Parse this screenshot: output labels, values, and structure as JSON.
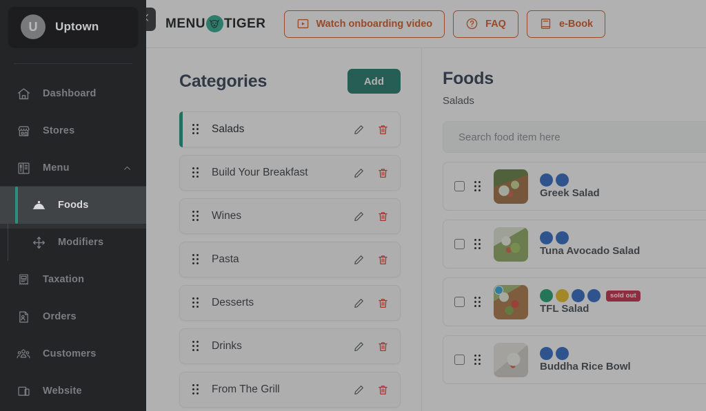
{
  "sidebar": {
    "brand": {
      "initial": "U",
      "name": "Uptown"
    },
    "items": [
      {
        "label": "Dashboard",
        "icon": "home-icon"
      },
      {
        "label": "Stores",
        "icon": "store-icon"
      },
      {
        "label": "Menu",
        "icon": "menu-book-icon",
        "expanded": true
      },
      {
        "label": "Foods",
        "icon": "food-cloche-icon",
        "sub": true,
        "active": true
      },
      {
        "label": "Modifiers",
        "icon": "move-arrows-icon",
        "sub": true
      },
      {
        "label": "Taxation",
        "icon": "tax-receipt-icon"
      },
      {
        "label": "Orders",
        "icon": "orders-icon"
      },
      {
        "label": "Customers",
        "icon": "customers-icon"
      },
      {
        "label": "Website",
        "icon": "website-icon"
      }
    ]
  },
  "topbar": {
    "collapse_icon": "chevron-left-icon",
    "logo": {
      "text_left": "MENU",
      "text_right": "TIGER",
      "mark": "tiger-face-icon"
    },
    "buttons": [
      {
        "label": "Watch onboarding video",
        "icon": "play-video-icon"
      },
      {
        "label": "FAQ",
        "icon": "question-circle-icon"
      },
      {
        "label": "e-Book",
        "icon": "book-icon"
      }
    ]
  },
  "categories": {
    "title": "Categories",
    "add_label": "Add",
    "items": [
      {
        "name": "Salads",
        "active": true
      },
      {
        "name": "Build Your Breakfast",
        "active": false
      },
      {
        "name": "Wines",
        "active": false
      },
      {
        "name": "Pasta",
        "active": false
      },
      {
        "name": "Desserts",
        "active": false
      },
      {
        "name": "Drinks",
        "active": false
      },
      {
        "name": "From The Grill",
        "active": false
      }
    ]
  },
  "foods": {
    "title": "Foods",
    "subtitle": "Salads",
    "search_placeholder": "Search food item here",
    "items": [
      {
        "name": "Greek Salad",
        "thumb": "greek-salad-photo",
        "corner_badge": false,
        "badges": [
          "allergen-blue-icon",
          "dietary-blue-icon"
        ],
        "sold_out": false,
        "sold_out_label": ""
      },
      {
        "name": "Tuna Avocado Salad",
        "thumb": "tuna-avocado-salad-photo",
        "corner_badge": false,
        "badges": [
          "allergen-blue-icon",
          "dietary-blue-icon"
        ],
        "sold_out": false,
        "sold_out_label": ""
      },
      {
        "name": "TFL Salad",
        "thumb": "tfl-salad-photo",
        "corner_badge": true,
        "badges": [
          "new-green-icon",
          "featured-star-icon",
          "allergen-blue-icon",
          "dietary-blue-icon"
        ],
        "sold_out": true,
        "sold_out_label": "sold out"
      },
      {
        "name": "Buddha Rice Bowl",
        "thumb": "buddha-rice-bowl-photo",
        "corner_badge": false,
        "badges": [
          "allergen-blue-icon",
          "dietary-blue-icon"
        ],
        "sold_out": false,
        "sold_out_label": ""
      }
    ]
  },
  "colors": {
    "sidebar_bg": "#232527",
    "accent_teal": "#17907c",
    "add_button": "#187567",
    "topbar_accent": "#d4541f",
    "delete_red": "#e8332a",
    "sold_out": "#c52343",
    "heading": "#28384c"
  }
}
